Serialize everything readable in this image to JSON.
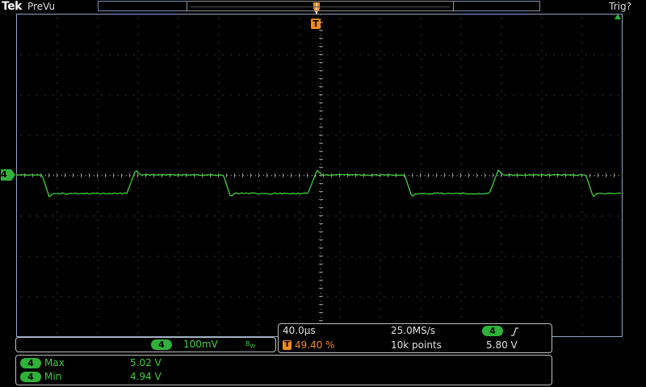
{
  "header": {
    "brand": "Tek",
    "mode": "PreVu",
    "trigger_status": "Trig?"
  },
  "trigger_marker": "T",
  "channel": {
    "marker": "4",
    "color": "#3fce3f",
    "scale": "100mV",
    "bandwidth_icon": "B_W"
  },
  "timebase": {
    "time_per_div": "40.0µs",
    "sample_rate": "25.0MS/s",
    "record_length": "10k points",
    "trigger_position": "49.40 %",
    "trigger_source": "4",
    "trigger_slope_icon": "rising-edge-icon",
    "trigger_level": "5.80 V"
  },
  "measurements": [
    {
      "channel": "4",
      "name": "Max",
      "value": "5.02 V"
    },
    {
      "channel": "4",
      "name": "Min",
      "value": "4.94 V"
    }
  ],
  "colors": {
    "trace": "#3fce3f",
    "grid_border": "#8ea6c9",
    "trigger": "#f08a1c",
    "grid_dots": "#6e6e6e"
  }
}
